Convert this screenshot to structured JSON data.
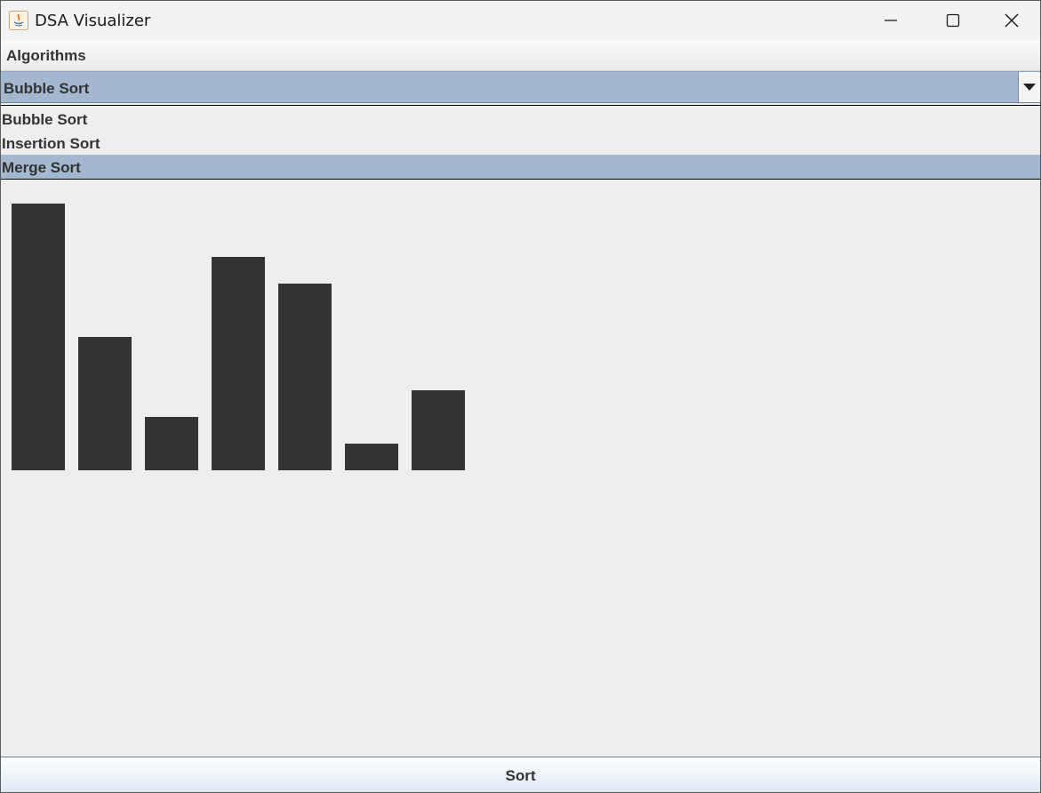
{
  "window": {
    "title": "DSA Visualizer"
  },
  "menubar": {
    "items": [
      "Algorithms"
    ]
  },
  "algorithm_select": {
    "value": "Bubble Sort",
    "options": [
      "Bubble Sort",
      "Insertion Sort",
      "Merge Sort"
    ],
    "highlighted": "Merge Sort"
  },
  "array": {
    "values": [
      10,
      5,
      2,
      8,
      7,
      1,
      3
    ],
    "bar_color": "#333333"
  },
  "sort_button": {
    "label": "Sort"
  },
  "colors": {
    "selection": "#a3b8cf",
    "background": "#eeeeee"
  }
}
